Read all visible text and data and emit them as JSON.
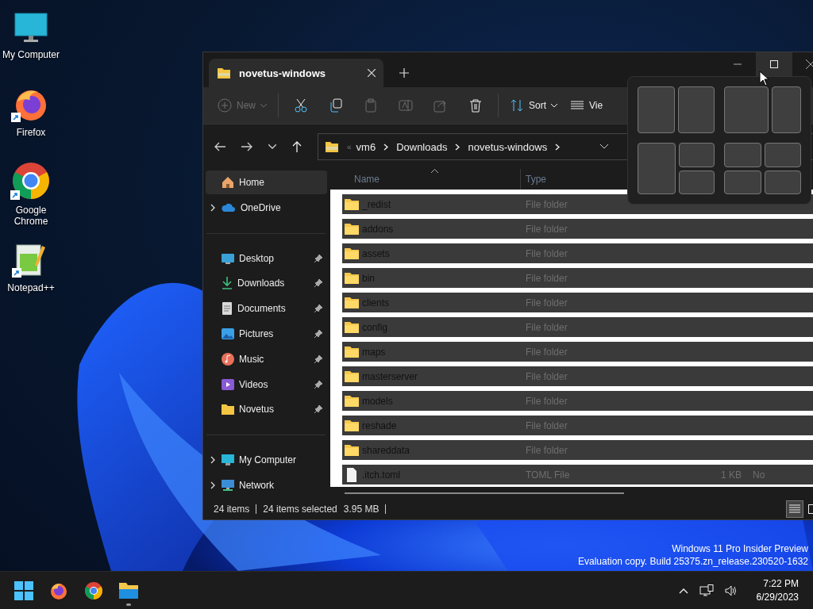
{
  "desktop": {
    "icons": [
      {
        "label": "My Computer",
        "shortcut": false
      },
      {
        "label": "Firefox",
        "shortcut": true
      },
      {
        "label": "Google Chrome",
        "shortcut": true
      },
      {
        "label": "Notepad++",
        "shortcut": true
      }
    ],
    "build_info": [
      "Windows 11 Pro Insider Preview",
      "Evaluation copy. Build 25375.zn_release.230520-1632"
    ]
  },
  "explorer": {
    "tabs": [
      {
        "title": "novetus-windows",
        "selected": true
      }
    ],
    "window_controls": [
      {
        "kind": "minimize",
        "hovered": false
      },
      {
        "kind": "maximize",
        "hovered": true
      },
      {
        "kind": "close",
        "hovered": false
      }
    ],
    "toolbar": [
      {
        "kind": "new",
        "label": "New",
        "disabled": true
      },
      {
        "kind": "cut",
        "disabled": false
      },
      {
        "kind": "copy",
        "disabled": false
      },
      {
        "kind": "paste",
        "disabled": true
      },
      {
        "kind": "rename",
        "disabled": true
      },
      {
        "kind": "share",
        "disabled": true
      },
      {
        "kind": "delete",
        "disabled": false
      },
      {
        "kind": "sort",
        "label": "Sort",
        "disabled": false
      },
      {
        "kind": "view",
        "label": "Vie",
        "disabled": false
      }
    ],
    "address": {
      "overflow": "«",
      "crumbs": [
        "vm6",
        "Downloads",
        "novetus-windows"
      ]
    },
    "sidebar": {
      "items": [
        {
          "label": "Home",
          "kind": "home",
          "selected": true
        },
        {
          "label": "OneDrive",
          "kind": "tree",
          "expanded": false,
          "selected": false
        },
        {
          "label": "Desktop",
          "kind": "pinned",
          "selected": false
        },
        {
          "label": "Downloads",
          "kind": "pinned",
          "selected": false
        },
        {
          "label": "Documents",
          "kind": "pinned",
          "selected": false
        },
        {
          "label": "Pictures",
          "kind": "pinned",
          "selected": false
        },
        {
          "label": "Music",
          "kind": "pinned",
          "selected": false
        },
        {
          "label": "Videos",
          "kind": "pinned",
          "selected": false
        },
        {
          "label": "Novetus",
          "kind": "pinned",
          "selected": false
        },
        {
          "label": "My Computer",
          "kind": "tree",
          "expanded": false,
          "selected": false
        },
        {
          "label": "Network",
          "kind": "tree",
          "expanded": false,
          "selected": false
        }
      ]
    },
    "columns": [
      {
        "label": "Name",
        "sorted": true
      },
      {
        "label": "Type",
        "sorted": false
      }
    ],
    "rows": [
      {
        "kind": "folder",
        "name": "_redist",
        "type": "File folder",
        "selected": true
      },
      {
        "kind": "folder",
        "name": "addons",
        "type": "File folder",
        "selected": true
      },
      {
        "kind": "folder",
        "name": "assets",
        "type": "File folder",
        "selected": true
      },
      {
        "kind": "folder",
        "name": "bin",
        "type": "File folder",
        "selected": true
      },
      {
        "kind": "folder",
        "name": "clients",
        "type": "File folder",
        "selected": true
      },
      {
        "kind": "folder",
        "name": "config",
        "type": "File folder",
        "selected": true
      },
      {
        "kind": "folder",
        "name": "maps",
        "type": "File folder",
        "selected": true
      },
      {
        "kind": "folder",
        "name": "masterserver",
        "type": "File folder",
        "selected": true
      },
      {
        "kind": "folder",
        "name": "models",
        "type": "File folder",
        "selected": true
      },
      {
        "kind": "folder",
        "name": "reshade",
        "type": "File folder",
        "selected": true
      },
      {
        "kind": "folder",
        "name": "shareddata",
        "type": "File folder",
        "selected": true
      },
      {
        "kind": "file",
        "name": ".itch.toml",
        "type": "TOML File",
        "size": "1 KB",
        "column_5": "No",
        "selected": true
      }
    ],
    "status": {
      "count": "24 items",
      "selected": "24 items selected",
      "size": "3.95 MB"
    },
    "view_buttons": [
      {
        "kind": "details",
        "selected": true
      },
      {
        "kind": "tiles",
        "selected": false
      }
    ]
  },
  "snap_layouts": [
    {
      "kind": "halves"
    },
    {
      "kind": "wide-left"
    },
    {
      "kind": "left-and-stack"
    },
    {
      "kind": "quarters"
    }
  ],
  "taskbar": {
    "apps": [
      {
        "kind": "start",
        "running": false
      },
      {
        "kind": "firefox",
        "running": false
      },
      {
        "kind": "chrome",
        "running": false
      },
      {
        "kind": "explorer",
        "running": true
      }
    ],
    "clock": {
      "time": "7:22 PM",
      "date": "6/29/2023"
    }
  }
}
